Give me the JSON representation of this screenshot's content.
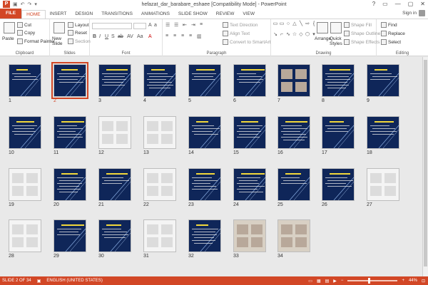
{
  "window": {
    "title": "hefazat_dar_barabare_eshaee [Compatibility Mode] - PowerPoint",
    "app_logo": "P",
    "controls": [
      "?",
      "▭",
      "—",
      "▢",
      "✕"
    ]
  },
  "qat": [
    "↶",
    "↷",
    "▣",
    "▾"
  ],
  "tabs": [
    "FILE",
    "HOME",
    "INSERT",
    "DESIGN",
    "TRANSITIONS",
    "ANIMATIONS",
    "SLIDE SHOW",
    "REVIEW",
    "VIEW"
  ],
  "active_tab": "HOME",
  "sign_in": "Sign in",
  "ribbon": {
    "clipboard": {
      "paste": "Paste",
      "cut": "Cut",
      "copy": "Copy",
      "format_painter": "Format Painter",
      "label": "Clipboard"
    },
    "slides": {
      "new_slide": "New Slide",
      "layout": "Layout",
      "reset": "Reset",
      "section": "Section",
      "label": "Slides"
    },
    "font": {
      "label": "Font"
    },
    "paragraph": {
      "text_direction": "Text Direction",
      "align_text": "Align Text",
      "convert_smartart": "Convert to SmartArt",
      "label": "Paragraph"
    },
    "drawing": {
      "arrange": "Arrange",
      "quick_styles": "Quick Styles",
      "shape_fill": "Shape Fill",
      "shape_outline": "Shape Outline",
      "shape_effects": "Shape Effects",
      "label": "Drawing"
    },
    "editing": {
      "find": "Find",
      "replace": "Replace",
      "select": "Select",
      "label": "Editing"
    }
  },
  "slides": [
    "1",
    "2",
    "3",
    "4",
    "5",
    "6",
    "7",
    "8",
    "9",
    "10",
    "11",
    "12",
    "13",
    "14",
    "15",
    "16",
    "17",
    "18",
    "19",
    "20",
    "21",
    "22",
    "23",
    "24",
    "25",
    "26",
    "27",
    "28",
    "29",
    "30",
    "31",
    "32",
    "33",
    "34"
  ],
  "selected_slide": "2",
  "status": {
    "slide_of": "SLIDE 2 OF 34",
    "language": "ENGLISH (UNITED STATES)",
    "zoom": "44%",
    "zoom_fraction": 0.44
  },
  "colors": {
    "accent": "#d24726",
    "slide_bg": "#0f2659",
    "slide_text": "#f2d83a"
  }
}
